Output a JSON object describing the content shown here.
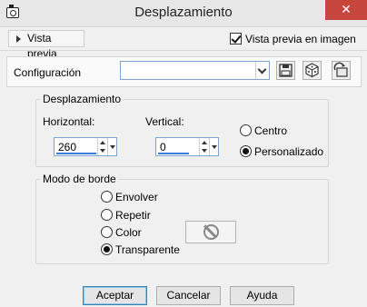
{
  "window": {
    "title": "Desplazamiento",
    "close_label": "✕"
  },
  "preview": {
    "toggle_label": "Vista previa",
    "checkbox_label": "Vista previa en imagen",
    "checkbox_checked": true
  },
  "config": {
    "label": "Configuración",
    "value": ""
  },
  "offset_group": {
    "title": "Desplazamiento",
    "horizontal_label": "Horizontal:",
    "vertical_label": "Vertical:",
    "horizontal_value": "260",
    "vertical_value": "0",
    "options": [
      {
        "label": "Centro",
        "checked": false
      },
      {
        "label": "Personalizado",
        "checked": true
      }
    ]
  },
  "border_group": {
    "title": "Modo de borde",
    "options": [
      {
        "label": "Envolver",
        "checked": false
      },
      {
        "label": "Repetir",
        "checked": false
      },
      {
        "label": "Color",
        "checked": false
      },
      {
        "label": "Transparente",
        "checked": true
      }
    ]
  },
  "buttons": {
    "ok": "Aceptar",
    "cancel": "Cancelar",
    "help": "Ayuda"
  },
  "colors": {
    "close_red": "#c6463e",
    "focus_blue": "#3a7bd5"
  }
}
